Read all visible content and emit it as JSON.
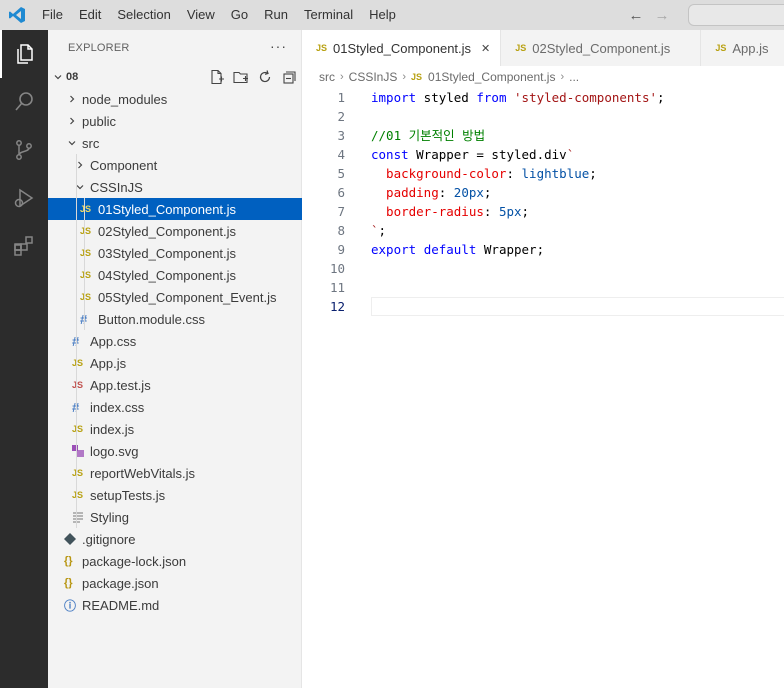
{
  "menu": [
    "File",
    "Edit",
    "Selection",
    "View",
    "Go",
    "Run",
    "Terminal",
    "Help"
  ],
  "explorer": {
    "title": "EXPLORER",
    "more": "···",
    "root_folder": "08",
    "tree": [
      {
        "label": "node_modules",
        "type": "folder",
        "depth": 1,
        "expanded": false
      },
      {
        "label": "public",
        "type": "folder",
        "depth": 1,
        "expanded": false
      },
      {
        "label": "src",
        "type": "folder",
        "depth": 1,
        "expanded": true
      },
      {
        "label": "Component",
        "type": "folder",
        "depth": 2,
        "expanded": false
      },
      {
        "label": "CSSInJS",
        "type": "folder",
        "depth": 2,
        "expanded": true
      },
      {
        "label": "01Styled_Component.js",
        "type": "js",
        "depth": 3,
        "selected": true
      },
      {
        "label": "02Styled_Component.js",
        "type": "js",
        "depth": 3
      },
      {
        "label": "03Styled_Component.js",
        "type": "js",
        "depth": 3
      },
      {
        "label": "04Styled_Component.js",
        "type": "js",
        "depth": 3
      },
      {
        "label": "05Styled_Component_Event.js",
        "type": "js",
        "depth": 3
      },
      {
        "label": "Button.module.css",
        "type": "css",
        "depth": 3
      },
      {
        "label": "App.css",
        "type": "css",
        "depth": 2
      },
      {
        "label": "App.js",
        "type": "js",
        "depth": 2
      },
      {
        "label": "App.test.js",
        "type": "test",
        "depth": 2
      },
      {
        "label": "index.css",
        "type": "css",
        "depth": 2
      },
      {
        "label": "index.js",
        "type": "js",
        "depth": 2
      },
      {
        "label": "logo.svg",
        "type": "svg",
        "depth": 2
      },
      {
        "label": "reportWebVitals.js",
        "type": "js",
        "depth": 2
      },
      {
        "label": "setupTests.js",
        "type": "js",
        "depth": 2
      },
      {
        "label": "Styling",
        "type": "text",
        "depth": 2
      },
      {
        "label": ".gitignore",
        "type": "git",
        "depth": 1
      },
      {
        "label": "package-lock.json",
        "type": "json",
        "depth": 1
      },
      {
        "label": "package.json",
        "type": "json",
        "depth": 1
      },
      {
        "label": "README.md",
        "type": "info",
        "depth": 1
      }
    ]
  },
  "tabs": [
    {
      "label": "01Styled_Component.js",
      "active": true
    },
    {
      "label": "02Styled_Component.js",
      "active": false
    },
    {
      "label": "App.js",
      "active": false
    }
  ],
  "breadcrumb": {
    "parts": [
      "src",
      "CSSInJS",
      "01Styled_Component.js",
      "..."
    ]
  },
  "editor": {
    "current_line": 12,
    "lines": [
      {
        "n": "1",
        "tokens": [
          {
            "t": "import",
            "c": "kw"
          },
          {
            "t": " styled ",
            "c": "plain"
          },
          {
            "t": "from",
            "c": "kw"
          },
          {
            "t": " ",
            "c": "plain"
          },
          {
            "t": "'styled-components'",
            "c": "str"
          },
          {
            "t": ";",
            "c": "plain"
          }
        ]
      },
      {
        "n": "2",
        "tokens": []
      },
      {
        "n": "3",
        "tokens": [
          {
            "t": "//01 기본적인 방법",
            "c": "cm"
          }
        ]
      },
      {
        "n": "4",
        "tokens": [
          {
            "t": "const",
            "c": "kw"
          },
          {
            "t": " Wrapper = styled.div",
            "c": "plain"
          },
          {
            "t": "`",
            "c": "tmpl"
          }
        ]
      },
      {
        "n": "5",
        "tokens": [
          {
            "t": "  background-color",
            "c": "css-prop"
          },
          {
            "t": ": ",
            "c": "plain"
          },
          {
            "t": "lightblue",
            "c": "css-val"
          },
          {
            "t": ";",
            "c": "plain"
          }
        ]
      },
      {
        "n": "6",
        "tokens": [
          {
            "t": "  padding",
            "c": "css-prop"
          },
          {
            "t": ": ",
            "c": "plain"
          },
          {
            "t": "20px",
            "c": "css-val"
          },
          {
            "t": ";",
            "c": "plain"
          }
        ]
      },
      {
        "n": "7",
        "tokens": [
          {
            "t": "  border-radius",
            "c": "css-prop"
          },
          {
            "t": ": ",
            "c": "plain"
          },
          {
            "t": "5px",
            "c": "css-val"
          },
          {
            "t": ";",
            "c": "plain"
          }
        ]
      },
      {
        "n": "8",
        "tokens": [
          {
            "t": "`",
            "c": "tmpl"
          },
          {
            "t": ";",
            "c": "plain"
          }
        ]
      },
      {
        "n": "9",
        "tokens": [
          {
            "t": "export",
            "c": "kw"
          },
          {
            "t": " ",
            "c": "plain"
          },
          {
            "t": "default",
            "c": "kw"
          },
          {
            "t": " Wrapper;",
            "c": "plain"
          }
        ]
      },
      {
        "n": "10",
        "tokens": []
      },
      {
        "n": "11",
        "tokens": []
      },
      {
        "n": "12",
        "tokens": []
      }
    ]
  },
  "colors": {
    "accent": "#0060c0",
    "activitybar": "#2c2c2c",
    "js_badge": "#b8a112",
    "css_badge": "#4c7fc4"
  }
}
